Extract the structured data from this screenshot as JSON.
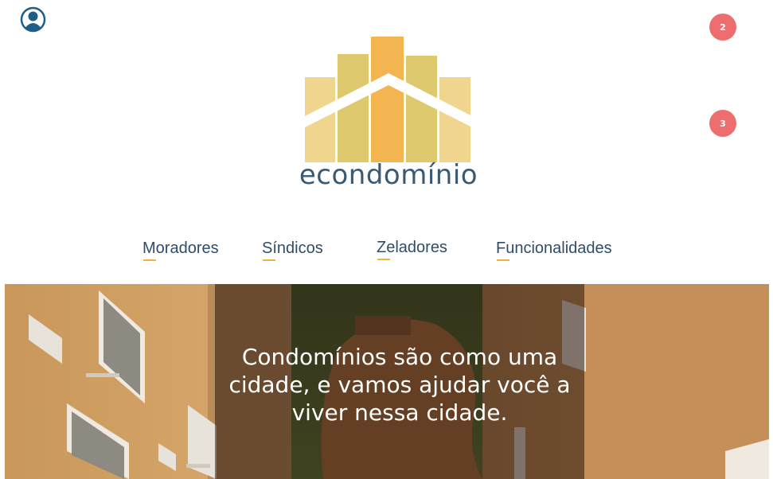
{
  "header": {
    "user_icon": "user-circle-icon",
    "badges": [
      "2",
      "3"
    ]
  },
  "logo": {
    "wordmark": "econdomínio",
    "colors": [
      "#f0d58e",
      "#dfc96f",
      "#f2b550"
    ]
  },
  "nav": {
    "items": [
      "Moradores",
      "Síndicos",
      "Zeladores",
      "Funcionalidades"
    ],
    "accent": "#f2b33c"
  },
  "hero": {
    "headline": "Condomínios são como uma cidade, e vamos ajudar você a viver nessa cidade."
  }
}
